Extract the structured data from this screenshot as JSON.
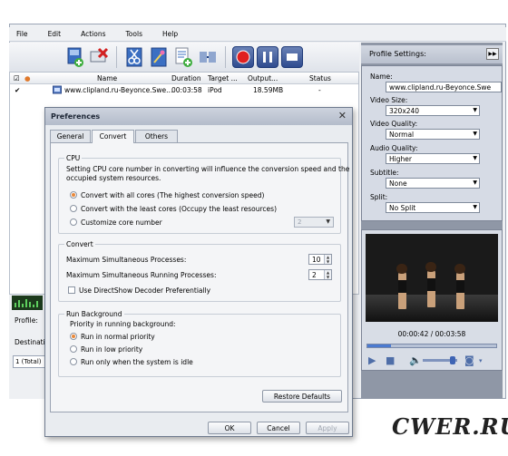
{
  "menu": [
    "File",
    "Edit",
    "Actions",
    "Tools",
    "Help"
  ],
  "filelist": {
    "columns": [
      "Name",
      "Duration",
      "Target ...",
      "Output...",
      "Status"
    ],
    "rows": [
      {
        "name": "www.clipland.ru-Beyonce.Swe...",
        "duration": "00:03:58",
        "target": "iPod",
        "output": "18.59MB",
        "status": "-"
      }
    ]
  },
  "left_panel": {
    "profile_label": "Profile:",
    "destination_label": "Destinati",
    "total": "1 (Total)"
  },
  "profile_settings": {
    "header": "Profile Settings:",
    "toggle": "▶▶",
    "fields": [
      {
        "label": "Name:",
        "value": "www.clipland.ru-Beyonce.Swe"
      },
      {
        "label": "Video Size:",
        "value": "320x240"
      },
      {
        "label": "Video Quality:",
        "value": "Normal"
      },
      {
        "label": "Audio Quality:",
        "value": "Higher"
      },
      {
        "label": "Subtitle:",
        "value": "None"
      },
      {
        "label": "Split:",
        "value": "No Split"
      }
    ]
  },
  "player": {
    "timecode": "00:00:42 / 00:03:58",
    "progress": 0.18,
    "volume": 0.8
  },
  "preferences": {
    "title": "Preferences",
    "close": "✕",
    "tabs": [
      "General",
      "Convert",
      "Others"
    ],
    "active_tab": "Convert",
    "cpu": {
      "title": "CPU",
      "description_line1": "Setting CPU core number in converting will influence the conversion speed and the",
      "description_line2": "occupied system resources.",
      "options": [
        "Convert with all cores (The highest conversion speed)",
        "Convert with the least cores (Occupy the least resources)",
        "Customize core number"
      ],
      "selected": 0,
      "core_value": "2"
    },
    "convert": {
      "title": "Convert",
      "max_processes_label": "Maximum Simultaneous Processes:",
      "max_processes": "10",
      "max_running_label": "Maximum Simultaneous Running Processes:",
      "max_running": "2",
      "directshow_label": "Use DirectShow Decoder Preferentially",
      "directshow_checked": false
    },
    "run_background": {
      "title": "Run Background",
      "priority_label": "Priority in running background:",
      "options": [
        "Run in normal priority",
        "Run in low priority",
        "Run only when the system is idle"
      ],
      "selected": 0
    },
    "restore_defaults": "Restore Defaults",
    "ok": "OK",
    "cancel": "Cancel",
    "apply": "Apply"
  },
  "watermark": "CWER.RU",
  "colors": {
    "accent_radio": "#e8883a",
    "panel_dark": "#8f97a6",
    "record": "#e02020"
  }
}
